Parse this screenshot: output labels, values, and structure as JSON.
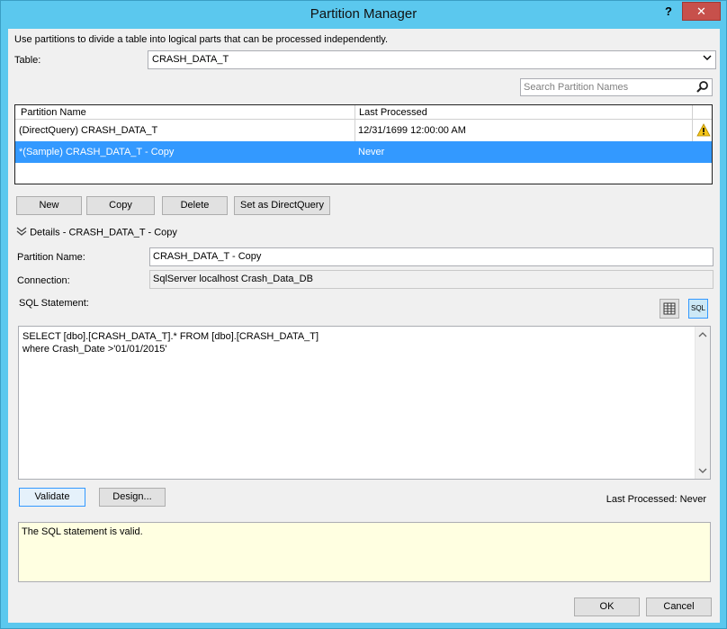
{
  "window": {
    "title": "Partition Manager",
    "help_label": "?",
    "close_label": "✕"
  },
  "description": "Use partitions to divide a table into logical parts that can be processed independently.",
  "table": {
    "label": "Table:",
    "value": "CRASH_DATA_T"
  },
  "search": {
    "placeholder": "Search Partition Names"
  },
  "grid": {
    "columns": [
      "Partition Name",
      "Last Processed"
    ],
    "rows": [
      {
        "name": "(DirectQuery) CRASH_DATA_T",
        "last_processed": "12/31/1699 12:00:00 AM",
        "warning": true
      },
      {
        "name": "*(Sample) CRASH_DATA_T - Copy",
        "last_processed": "Never",
        "selected": true
      }
    ]
  },
  "buttons": {
    "new": "New",
    "copy": "Copy",
    "delete": "Delete",
    "set_directquery": "Set as DirectQuery"
  },
  "details": {
    "header": "Details - CRASH_DATA_T - Copy",
    "partition_name_label": "Partition Name:",
    "partition_name_value": "CRASH_DATA_T - Copy",
    "connection_label": "Connection:",
    "connection_value": "SqlServer localhost Crash_Data_DB",
    "sql_label": "SQL Statement:",
    "sql_text": "SELECT [dbo].[CRASH_DATA_T].* FROM [dbo].[CRASH_DATA_T]\nwhere Crash_Date >'01/01/2015'",
    "sql_icon_label": "SQL"
  },
  "actions": {
    "validate": "Validate",
    "design": "Design..."
  },
  "last_processed": "Last Processed: Never",
  "result_message": "The SQL statement is valid.",
  "footer": {
    "ok": "OK",
    "cancel": "Cancel"
  },
  "colors": {
    "titlebar": "#5bc8ee",
    "close": "#c7504b",
    "selection": "#3399ff",
    "result_bg": "#ffffe1"
  }
}
